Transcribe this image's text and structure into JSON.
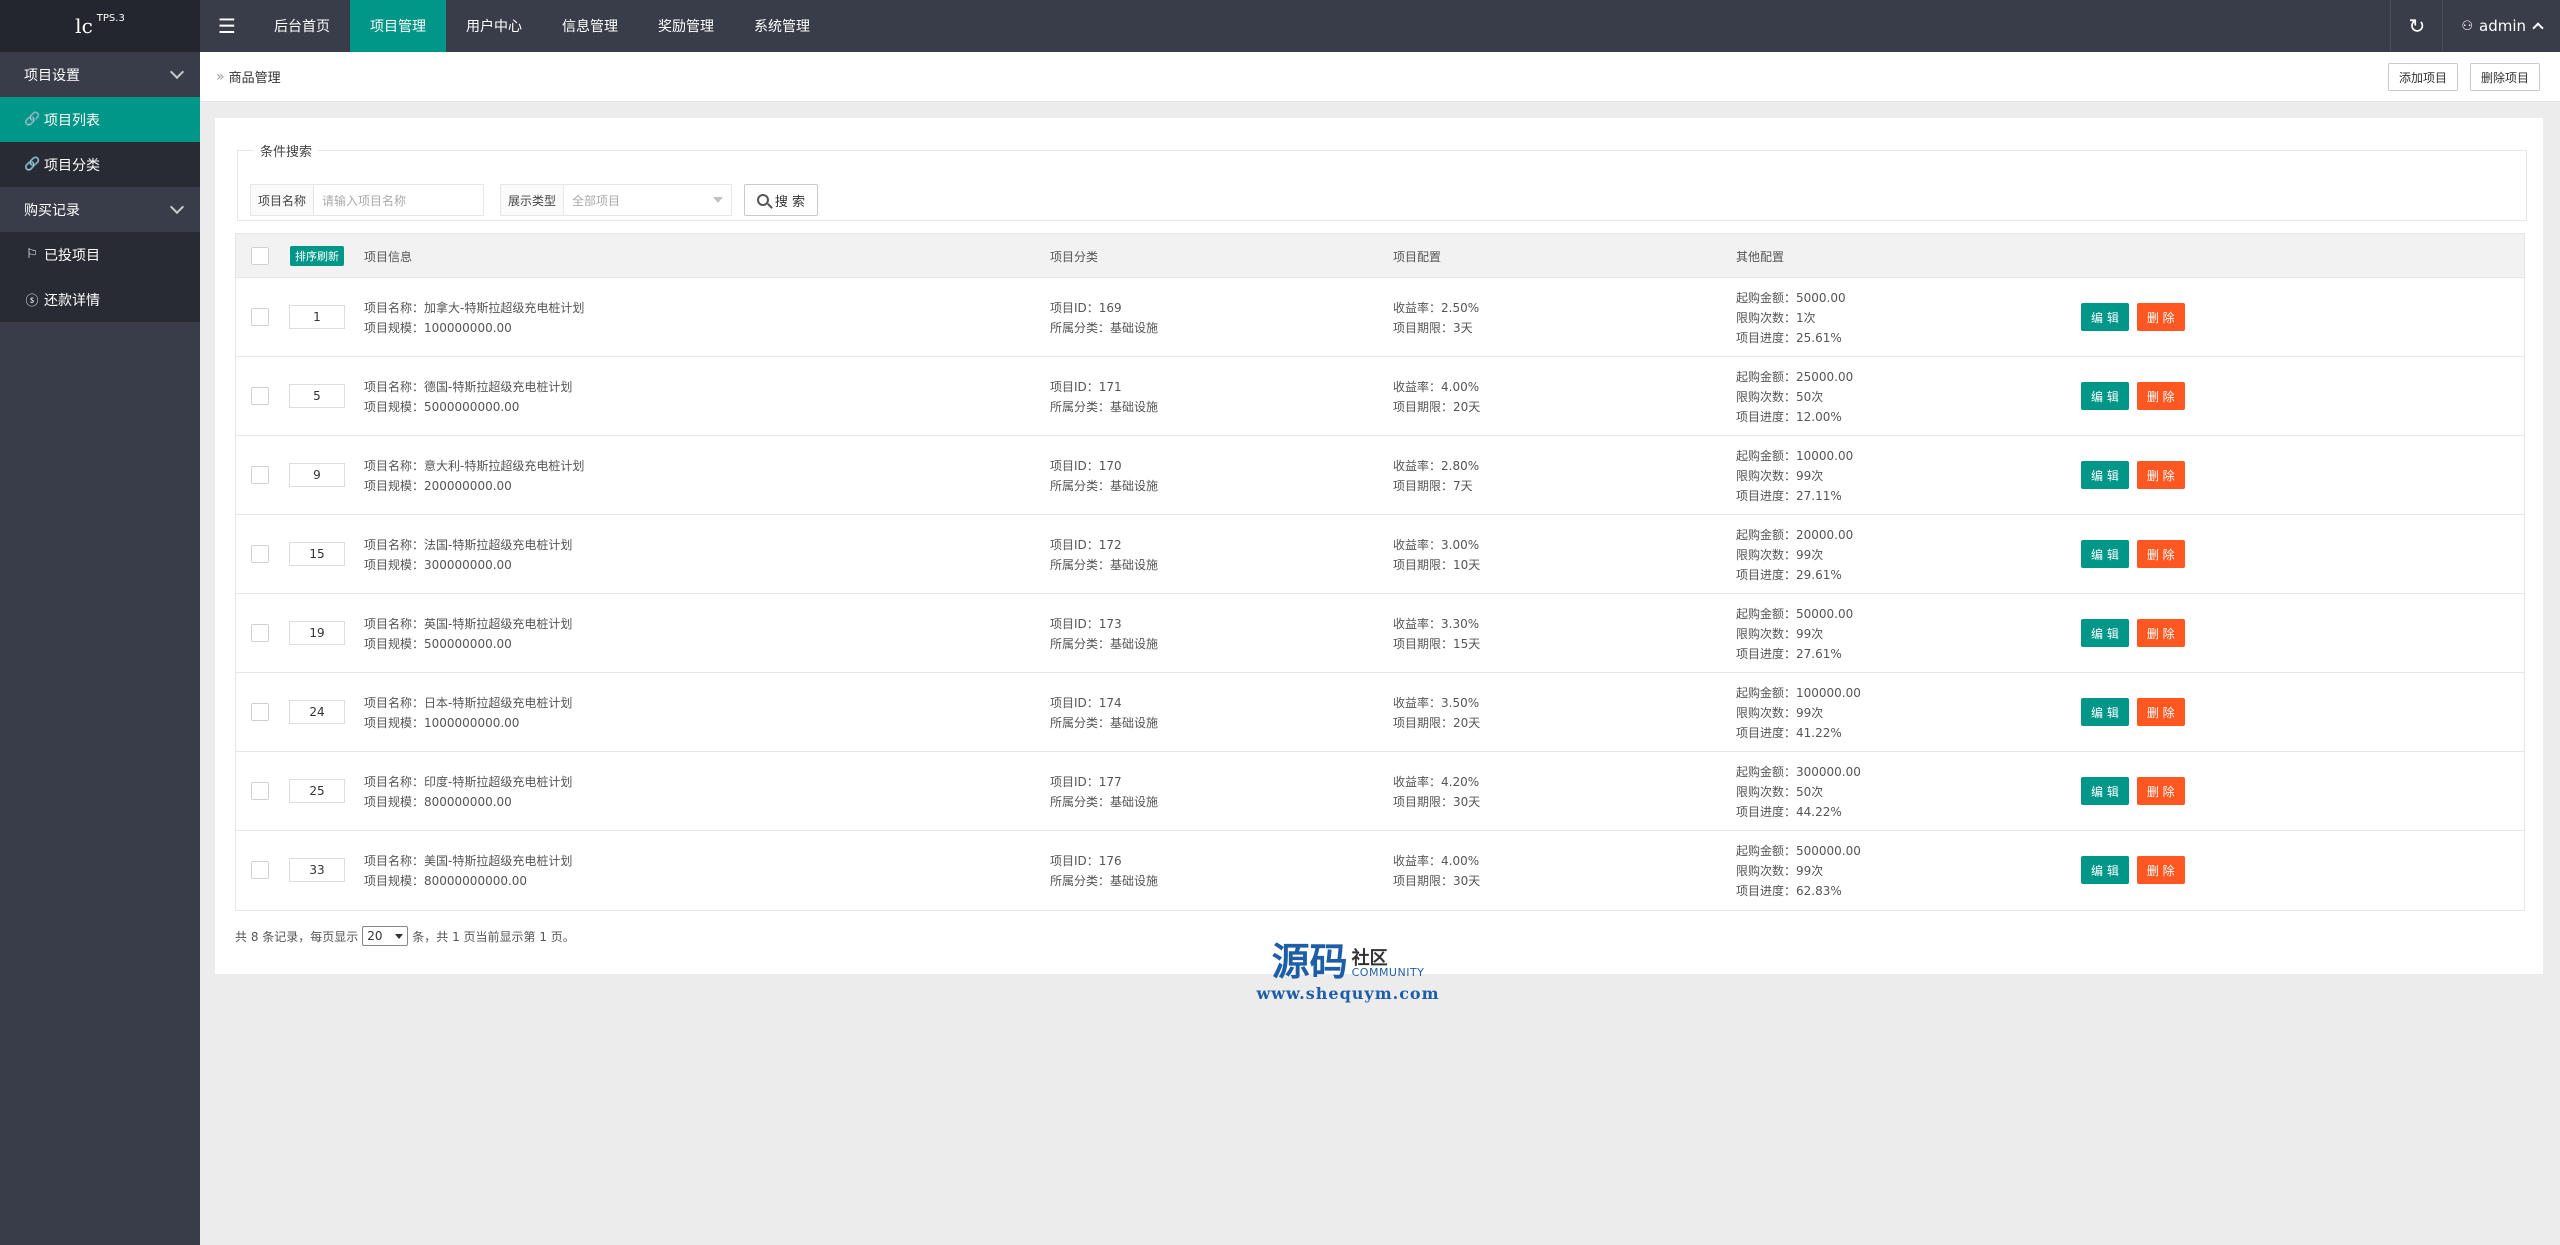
{
  "logo": {
    "main": "lc",
    "sup": "TPS.3"
  },
  "sidebar": {
    "groups": [
      {
        "label": "项目设置",
        "items": [
          {
            "label": "项目列表",
            "icon": "link-icon"
          },
          {
            "label": "项目分类",
            "icon": "link-icon"
          }
        ]
      },
      {
        "label": "购买记录",
        "items": [
          {
            "label": "已投项目",
            "icon": "flag-icon"
          },
          {
            "label": "还款详情",
            "icon": "dollar-icon"
          }
        ]
      }
    ]
  },
  "topnav": {
    "items": [
      "后台首页",
      "项目管理",
      "用户中心",
      "信息管理",
      "奖励管理",
      "系统管理"
    ],
    "user": "admin"
  },
  "breadcrumb": {
    "current": "商品管理",
    "add_button": "添加项目",
    "delete_button": "删除项目"
  },
  "search": {
    "legend": "条件搜索",
    "name_label": "项目名称",
    "name_placeholder": "请输入项目名称",
    "type_label": "展示类型",
    "type_value": "全部项目",
    "button": "搜 索"
  },
  "table": {
    "sort_button": "排序刷新",
    "headers": [
      "项目信息",
      "项目分类",
      "项目配置",
      "其他配置"
    ],
    "edit_label": "编 辑",
    "delete_label": "删 除",
    "rows": [
      {
        "sort": "1",
        "name": "项目名称：加拿大-特斯拉超级充电桩计划",
        "scale": "项目规模：100000000.00",
        "id": "项目ID：169",
        "category": "所属分类：基础设施",
        "rate": "收益率：2.50%",
        "period": "项目期限：3天",
        "min": "起购金额：5000.00",
        "limit": "限购次数：1次",
        "progress": "项目进度：25.61%"
      },
      {
        "sort": "5",
        "name": "项目名称：德国-特斯拉超级充电桩计划",
        "scale": "项目规模：5000000000.00",
        "id": "项目ID：171",
        "category": "所属分类：基础设施",
        "rate": "收益率：4.00%",
        "period": "项目期限：20天",
        "min": "起购金额：25000.00",
        "limit": "限购次数：50次",
        "progress": "项目进度：12.00%"
      },
      {
        "sort": "9",
        "name": "项目名称：意大利-特斯拉超级充电桩计划",
        "scale": "项目规模：200000000.00",
        "id": "项目ID：170",
        "category": "所属分类：基础设施",
        "rate": "收益率：2.80%",
        "period": "项目期限：7天",
        "min": "起购金额：10000.00",
        "limit": "限购次数：99次",
        "progress": "项目进度：27.11%"
      },
      {
        "sort": "15",
        "name": "项目名称：法国-特斯拉超级充电桩计划",
        "scale": "项目规模：300000000.00",
        "id": "项目ID：172",
        "category": "所属分类：基础设施",
        "rate": "收益率：3.00%",
        "period": "项目期限：10天",
        "min": "起购金额：20000.00",
        "limit": "限购次数：99次",
        "progress": "项目进度：29.61%"
      },
      {
        "sort": "19",
        "name": "项目名称：英国-特斯拉超级充电桩计划",
        "scale": "项目规模：500000000.00",
        "id": "项目ID：173",
        "category": "所属分类：基础设施",
        "rate": "收益率：3.30%",
        "period": "项目期限：15天",
        "min": "起购金额：50000.00",
        "limit": "限购次数：99次",
        "progress": "项目进度：27.61%"
      },
      {
        "sort": "24",
        "name": "项目名称：日本-特斯拉超级充电桩计划",
        "scale": "项目规模：1000000000.00",
        "id": "项目ID：174",
        "category": "所属分类：基础设施",
        "rate": "收益率：3.50%",
        "period": "项目期限：20天",
        "min": "起购金额：100000.00",
        "limit": "限购次数：99次",
        "progress": "项目进度：41.22%"
      },
      {
        "sort": "25",
        "name": "项目名称：印度-特斯拉超级充电桩计划",
        "scale": "项目规模：800000000.00",
        "id": "项目ID：177",
        "category": "所属分类：基础设施",
        "rate": "收益率：4.20%",
        "period": "项目期限：30天",
        "min": "起购金额：300000.00",
        "limit": "限购次数：50次",
        "progress": "项目进度：44.22%"
      },
      {
        "sort": "33",
        "name": "项目名称：美国-特斯拉超级充电桩计划",
        "scale": "项目规模：80000000000.00",
        "id": "项目ID：176",
        "category": "所属分类：基础设施",
        "rate": "收益率：4.00%",
        "period": "项目期限：30天",
        "min": "起购金额：500000.00",
        "limit": "限购次数：99次",
        "progress": "项目进度：62.83%"
      }
    ]
  },
  "pager": {
    "before": "共 8 条记录，每页显示",
    "per_page": "20",
    "after": "条，共 1 页当前显示第 1 页。"
  },
  "watermark": {
    "big": "源码",
    "cn": "社区",
    "en": "COMMUNITY",
    "url": "www.shequym.com"
  },
  "colors": {
    "sidebar": "#393d49",
    "accent": "#009688",
    "danger": "#ff5722"
  }
}
